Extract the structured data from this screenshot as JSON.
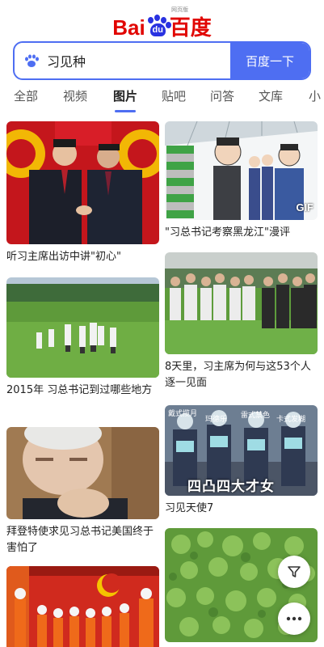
{
  "logo": {
    "left": "Bai",
    "paw_text": "du",
    "right": "百度",
    "sub": "网页版"
  },
  "search": {
    "query": "习见种",
    "button_label": "百度一下"
  },
  "tabs": [
    "全部",
    "视频",
    "图片",
    "贴吧",
    "问答",
    "文库",
    "小"
  ],
  "active_tab": "图片",
  "results": [
    {
      "caption": "听习主席出访中讲\"初心\""
    },
    {
      "caption": "2015年 习总书记到过哪些地方"
    },
    {
      "caption": "拜登特使求见习总书记美国终于害怕了"
    },
    {
      "caption": "\"习总书记考察黑龙江\"漫评"
    },
    {
      "caption": "8天里，习主席为何与这53个人逐一见面"
    },
    {
      "caption": "习见天使7"
    }
  ],
  "image_texts": {
    "gif_badge": "GIF",
    "angel_banner": "四凸四大才女",
    "angel_labels": [
      "戴式揽月",
      "玛德乐",
      "雷式禁色",
      "卡式发糊"
    ]
  },
  "icons": {
    "search": "paw-search-icon",
    "filter": "filter-icon",
    "more": "more-dots-icon"
  },
  "colors": {
    "brand_blue": "#4e6ef2",
    "brand_red": "#e10602"
  }
}
